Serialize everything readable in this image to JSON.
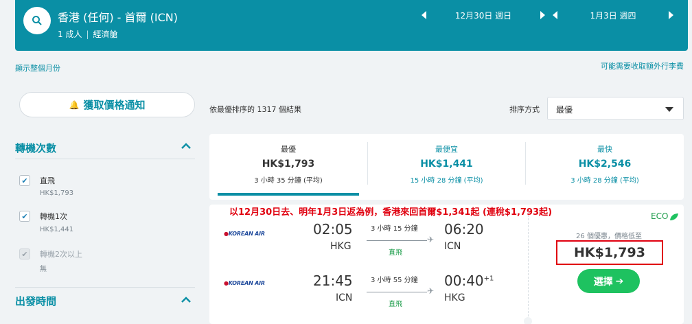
{
  "header": {
    "route": "香港 (任何) - 首爾 (ICN)",
    "passengers": "1 成人",
    "cabin": "經濟艙",
    "depart_date": "12月30日 週日",
    "return_date": "1月3日 週四"
  },
  "links": {
    "whole_month": "顯示整個月份",
    "extra_fees": "可能需要收取額外行李費"
  },
  "sidebar": {
    "price_alert": "獲取價格通知",
    "stops": {
      "title": "轉機次數",
      "options": [
        {
          "label": "直飛",
          "price": "HK$1,793",
          "checked": true,
          "disabled": false
        },
        {
          "label": "轉機1次",
          "price": "HK$1,441",
          "checked": true,
          "disabled": false
        },
        {
          "label": "轉機2次以上",
          "price": "無",
          "checked": true,
          "disabled": true
        }
      ]
    },
    "departure_time": {
      "title": "出發時間"
    }
  },
  "results": {
    "count_text": "依最優排序的 1317 個結果",
    "sort_label": "排序方式",
    "sort_value": "最優"
  },
  "tabs": [
    {
      "title": "最優",
      "price": "HK$1,793",
      "time": "3 小時 35 分鐘 (平均)"
    },
    {
      "title": "最便宜",
      "price": "HK$1,441",
      "time": "15 小時 28 分鐘 (平均)"
    },
    {
      "title": "最快",
      "price": "HK$2,546",
      "time": "3 小時 28 分鐘 (平均)"
    }
  ],
  "card": {
    "promo": "以12月30日去、明年1月3日返為例，香港來回首爾$1,341起 (連稅$1,793起)",
    "airline": "KOREAN AIR",
    "outbound": {
      "dep_time": "02:05",
      "dep_code": "HKG",
      "duration": "3 小時 15 分鐘",
      "stops": "直飛",
      "arr_time": "06:20",
      "arr_code": "ICN"
    },
    "inbound": {
      "dep_time": "21:45",
      "dep_code": "ICN",
      "duration": "3 小時 55 分鐘",
      "stops": "直飛",
      "arr_time": "00:40",
      "arr_plus": "+1",
      "arr_code": "HKG"
    },
    "eco": "ECO",
    "deals": "26 個優惠，價格低至",
    "price": "HK$1,793",
    "select": "選擇"
  },
  "colors": {
    "brand": "#0a8fa5",
    "cta": "#1ec260",
    "promo": "#e0000f"
  }
}
